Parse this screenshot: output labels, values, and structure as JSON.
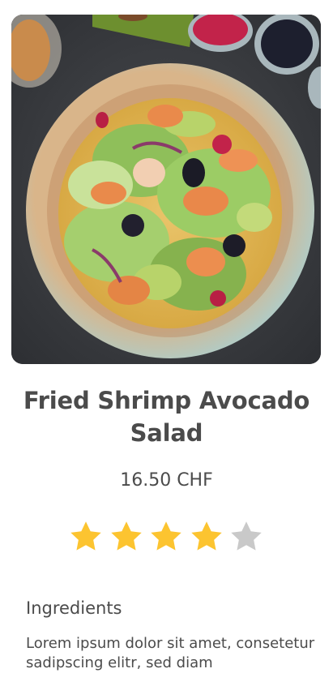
{
  "product": {
    "image": "salad-photo",
    "title_line1": "Fried Shrimp Avocado",
    "title_line2": "Salad",
    "price": "16.50 CHF",
    "rating": 4,
    "rating_max": 5
  },
  "ingredients": {
    "heading": "Ingredients",
    "text": "Lorem ipsum dolor sit amet, consetetur sadipscing elitr, sed diam"
  },
  "colors": {
    "star_filled": "#FCC430",
    "star_empty": "#C9C9C9",
    "text": "#4B4B4B"
  }
}
